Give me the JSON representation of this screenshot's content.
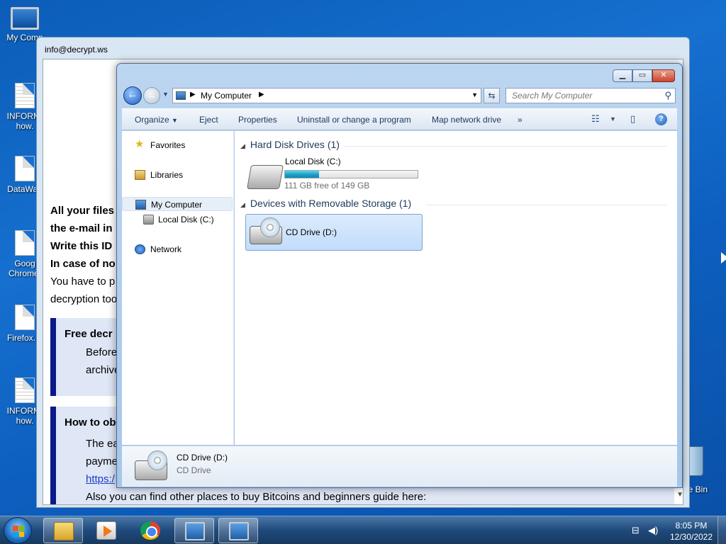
{
  "desktop": {
    "icons": [
      {
        "label": "My Comp"
      },
      {
        "label": "INFORM. how."
      },
      {
        "label": "DataWag"
      },
      {
        "label": "Goog Chrome."
      },
      {
        "label": "Firefox.In"
      },
      {
        "label": "INFORM. how."
      }
    ],
    "recycle_bin_label": "cle Bin"
  },
  "note_window": {
    "title": "info@decrypt.ws",
    "lines": [
      "All your files",
      "the e-mail  in",
      "Write this ID",
      "In case of no",
      "You have to p",
      "decryption too"
    ],
    "box1": {
      "heading": "Free decr",
      "lines": [
        "Before",
        "archive"
      ]
    },
    "box2": {
      "heading": "How to ob",
      "lines": [
        "The ea",
        "payme"
      ],
      "link": "https:/",
      "last_line": "Also you can find other places to buy Bitcoins and beginners guide here:"
    }
  },
  "explorer": {
    "breadcrumb": "My Computer",
    "search_placeholder": "Search My Computer",
    "toolbar": {
      "organize": "Organize",
      "eject": "Eject",
      "properties": "Properties",
      "uninstall": "Uninstall or change a program",
      "map_drive": "Map network drive",
      "more": "»"
    },
    "nav": {
      "favorites": "Favorites",
      "libraries": "Libraries",
      "my_computer": "My Computer",
      "local_disk": "Local Disk (C:)",
      "network": "Network"
    },
    "groups": {
      "hdd_header": "Hard Disk Drives (1)",
      "removable_header": "Devices with Removable Storage (1)"
    },
    "local_disk": {
      "name": "Local Disk (C:)",
      "free_text": "111 GB free of 149 GB",
      "used_fraction": 0.255
    },
    "cd_drive": {
      "name": "CD Drive (D:)"
    },
    "details": {
      "name": "CD Drive (D:)",
      "type": "CD Drive"
    }
  },
  "taskbar": {
    "time": "8:05 PM",
    "date": "12/30/2022"
  },
  "colors": {
    "accent": "#1d5fbf",
    "usage_fill": "#1b9fc6",
    "selection": "#c1dcfc"
  }
}
